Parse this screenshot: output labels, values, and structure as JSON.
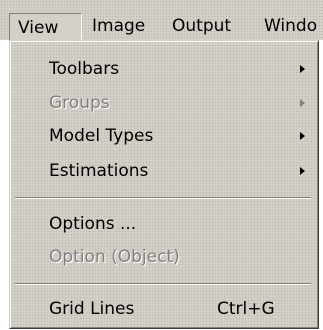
{
  "menubar": {
    "items": [
      {
        "label": "View"
      },
      {
        "label": "Image"
      },
      {
        "label": "Output"
      },
      {
        "label": "Windo"
      }
    ]
  },
  "menu": {
    "open_menu": "View",
    "items": [
      {
        "label": "Toolbars",
        "enabled": true,
        "submenu": true,
        "icon": "chevron-right-icon"
      },
      {
        "label": "Groups",
        "enabled": false,
        "submenu": true,
        "icon": "chevron-right-icon"
      },
      {
        "label": "Model Types",
        "enabled": true,
        "submenu": true,
        "icon": "chevron-right-icon"
      },
      {
        "label": "Estimations",
        "enabled": true,
        "submenu": true,
        "icon": "chevron-right-icon"
      },
      {
        "label": "Options ...",
        "enabled": true,
        "submenu": false
      },
      {
        "label": "Option (Object)",
        "enabled": false,
        "submenu": false
      },
      {
        "label": "Grid Lines",
        "shortcut": "Ctrl+G",
        "enabled": true,
        "submenu": false
      }
    ]
  },
  "colors": {
    "menu_background": "#d4d0c8",
    "disabled_text": "#808080",
    "text": "#000000"
  }
}
